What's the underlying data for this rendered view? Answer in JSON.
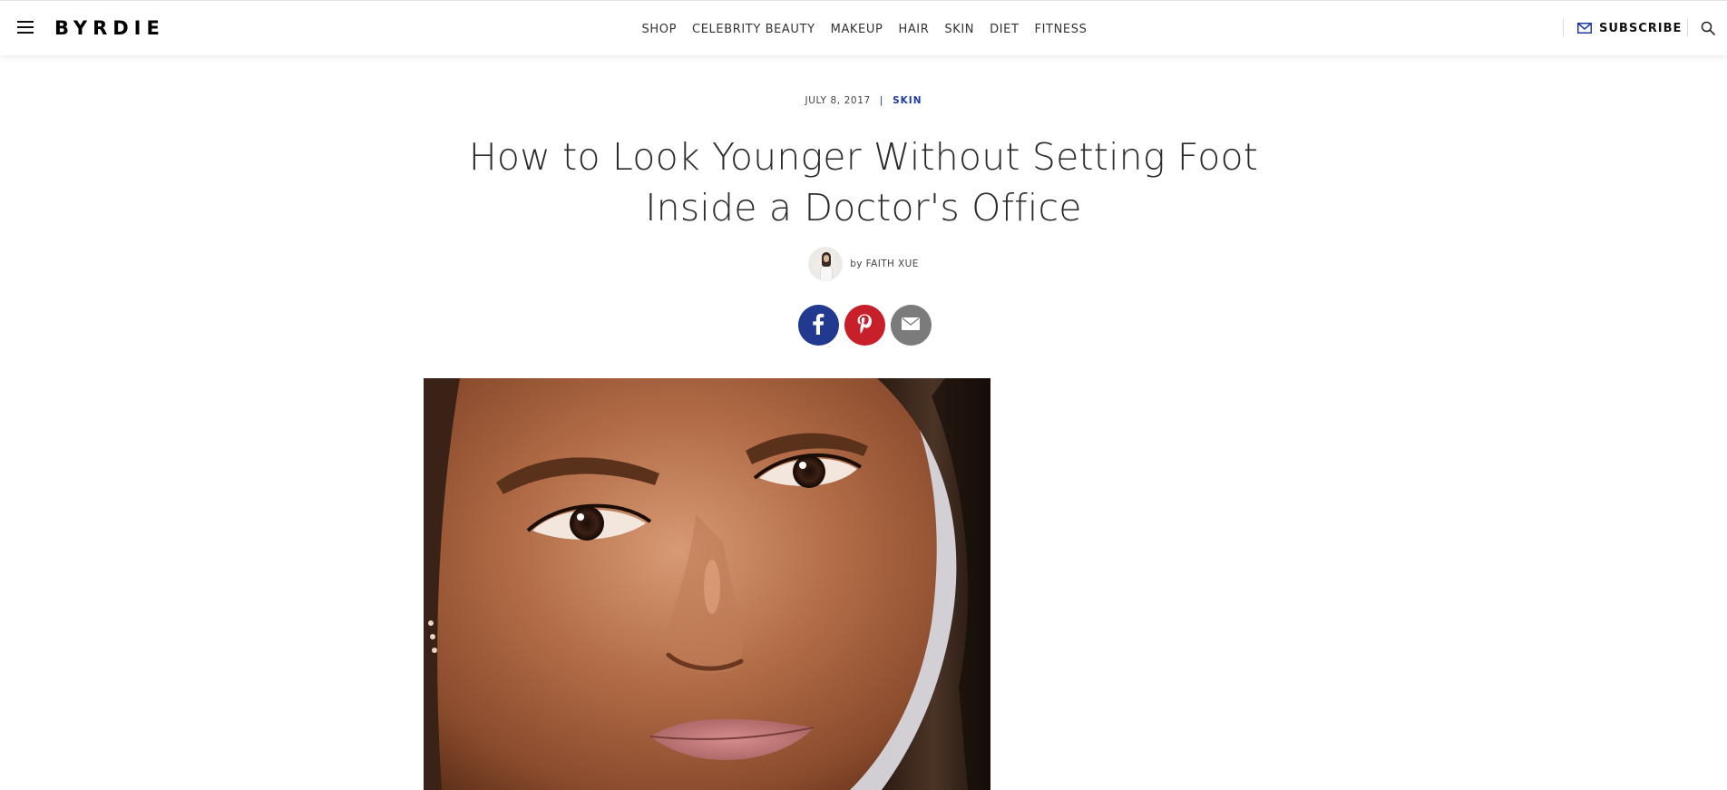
{
  "brand": {
    "logo": "BYRDIE"
  },
  "nav": {
    "items": [
      "SHOP",
      "CELEBRITY BEAUTY",
      "MAKEUP",
      "HAIR",
      "SKIN",
      "DIET",
      "FITNESS"
    ]
  },
  "header": {
    "subscribe_label": "SUBSCRIBE",
    "menu_icon": "hamburger-menu-icon",
    "search_icon": "search-icon",
    "subscribe_icon": "envelope-icon"
  },
  "article": {
    "date": "JULY 8, 2017",
    "separator": "|",
    "category": "SKIN",
    "title": "How to Look Younger Without Setting Foot Inside a Doctor's Office",
    "byline_prefix": "by",
    "author": "FAITH XUE"
  },
  "share": {
    "buttons": [
      {
        "name": "facebook",
        "icon": "facebook-icon",
        "color": "#213a8f"
      },
      {
        "name": "pinterest",
        "icon": "pinterest-icon",
        "color": "#c8202b"
      },
      {
        "name": "email",
        "icon": "email-icon",
        "color": "#7b7b7b"
      }
    ]
  },
  "colors": {
    "accent": "#1e3aa5",
    "text": "#2a2a2a"
  }
}
